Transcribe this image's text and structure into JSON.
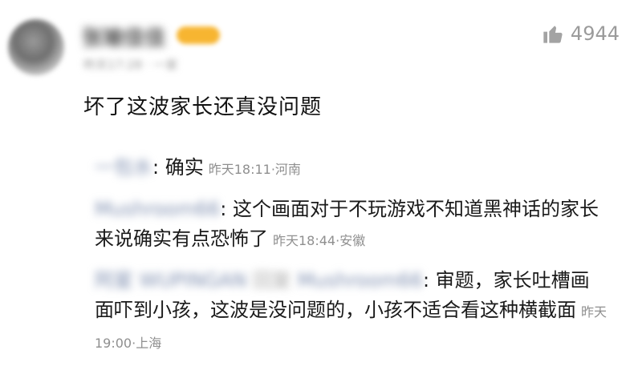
{
  "post": {
    "avatar_icon": "avatar-icon",
    "username": "张瑜佳佳",
    "meta": "昨天17:28 · 一家",
    "likes_icon": "thumbs-up-icon",
    "likes": "4944",
    "comment": "坏了这波家长还真没问题"
  },
  "replies": [
    {
      "name": "一包水",
      "text": ": 确实",
      "time": "昨天18:11·河南"
    },
    {
      "name": "Mushroom66",
      "text": ": 这个画面对于不玩游戏不知道黑神话的家长来说确实有点恐怖了",
      "time": "昨天18:44·安徽"
    },
    {
      "name": "阿星 WUPINGAN",
      "mid": "回复",
      "target": "Mushroom66",
      "text": ": 审题，家长吐槽画面吓到小孩，这波是没问题的，小孩不适合看这种横截面",
      "time": "昨天19:00·上海"
    }
  ]
}
